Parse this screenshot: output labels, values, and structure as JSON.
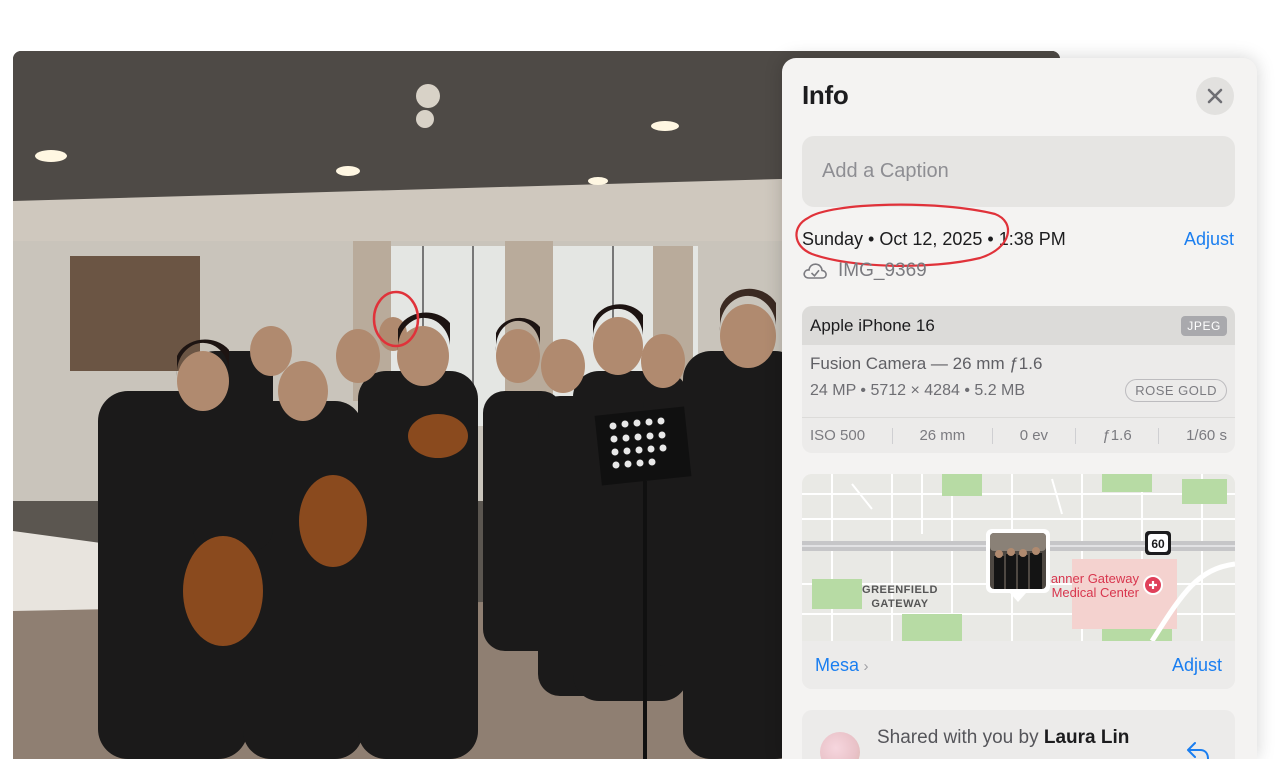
{
  "panel": {
    "title": "Info",
    "close_icon": "close-icon"
  },
  "caption": {
    "placeholder": "Add a Caption",
    "value": ""
  },
  "datetime": {
    "text": "Sunday • Oct 12, 2025 • 1:38 PM",
    "adjust_label": "Adjust",
    "annotation_color": "#e0323a"
  },
  "file": {
    "icon": "icloud-icon",
    "name": "IMG_9369"
  },
  "camera": {
    "device": "Apple iPhone 16",
    "format_badge": "JPEG",
    "lens": "Fusion Camera — 26 mm ƒ1.6",
    "specs": "24 MP • 5712 × 4284 • 5.2 MB",
    "color_badge": "ROSE GOLD",
    "exif": {
      "iso": "ISO 500",
      "focal": "26 mm",
      "ev": "0 ev",
      "aperture": "ƒ1.6",
      "shutter": "1/60 s"
    }
  },
  "map": {
    "labels": {
      "area": "GREENFIELD\nGATEWAY",
      "area_line1": "GREENFIELD",
      "area_line2": "GATEWAY",
      "poi_line1": "Banner Gateway",
      "poi_line2": "Medical Center",
      "route": "60"
    },
    "location": "Mesa",
    "adjust_label": "Adjust",
    "colors": {
      "accent": "#1a7ef0",
      "poi": "#e0405a",
      "land": "#e9e9e5",
      "green": "#b7dba4",
      "pink_zone": "#f4d2cf"
    }
  },
  "shared": {
    "prefix": "Shared with you by ",
    "name": "Laura Lin",
    "icon": "reply-icon"
  }
}
